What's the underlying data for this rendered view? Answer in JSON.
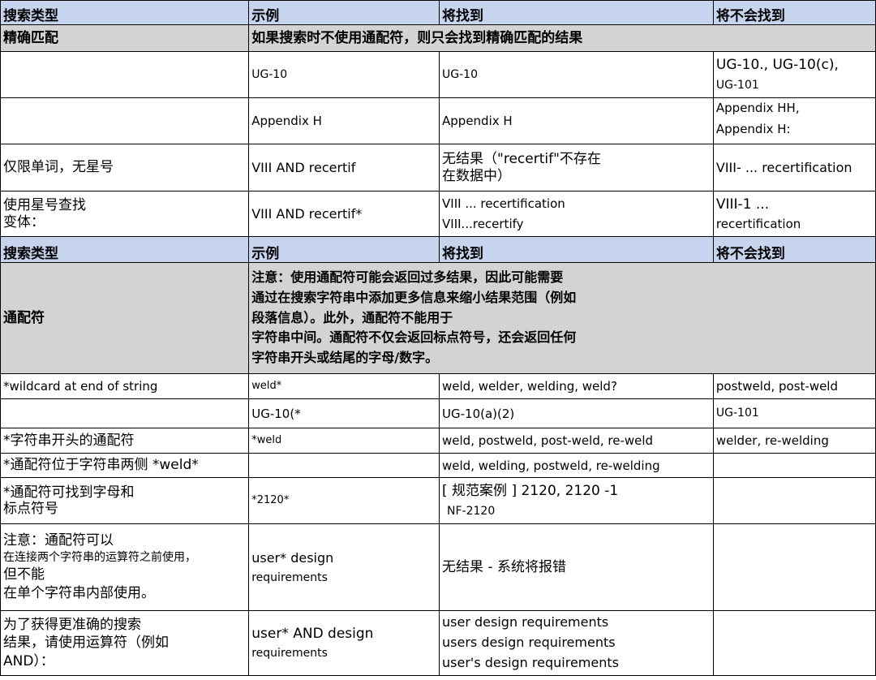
{
  "header": {
    "col1": "搜索类型",
    "col2": "示例",
    "col3": "将找到",
    "col4": "将不会找到"
  },
  "exact": {
    "label": "精确匹配",
    "note": "如果搜索时不使用通配符，则只会找到精确匹配的结果"
  },
  "rows_a": {
    "r1": {
      "example": "UG-10",
      "finds": "UG-10",
      "not_line1": "UG-10., UG-10(c),",
      "not_line2": "UG-101"
    },
    "r2": {
      "example": "Appendix H",
      "finds": "Appendix H",
      "not_line1": "Appendix HH,",
      "not_line2": "Appendix H:"
    },
    "r3": {
      "type": "仅限单词，无星号",
      "example": "VIII AND recertif",
      "finds_line1": "无结果（\"recertif\"不存在",
      "finds_line2": "在数据中）",
      "not": "VIII- ... recertification"
    },
    "r4": {
      "type_line1": "使用星号查找",
      "type_line2": "变体：",
      "example": "VIII AND recertif*",
      "finds_line1": "VIII ... recertification",
      "finds_line2": "VIII...recertify",
      "not_line1": "VIII-1 ...",
      "not_line2": "recertification"
    }
  },
  "wildcard": {
    "label": "通配符",
    "note_lines": [
      "注意：使用通配符可能会返回过多结果，因此可能需要",
      "通过在搜索字符串中添加更多信息来缩小结果范围（例如",
      "段落信息）。此外，通配符不能用于",
      "字符串中间。通配符不仅会返回标点符号，还会返回任何",
      "字符串开头或结尾的字母/数字。"
    ]
  },
  "rows_b": {
    "r1": {
      "type": "*wildcard at end of string",
      "example": "weld*",
      "finds": "weld, welder, welding, weld?",
      "not": "postweld, post-weld"
    },
    "r2": {
      "type": "",
      "example": "UG-10(*",
      "finds": "UG-10(a)(2)",
      "not": "UG-101"
    },
    "r3": {
      "type": "*字符串开头的通配符",
      "example": "*weld",
      "finds": "weld, postweld, post-weld, re-weld",
      "not": "welder, re-welding"
    },
    "r4": {
      "type": "*通配符位于字符串两侧 *weld*",
      "example": "",
      "finds": "weld, welding, postweld, re-welding",
      "not": ""
    },
    "r5": {
      "type_line1": "*通配符可找到字母和",
      "type_line2": "标点符号",
      "example": "*2120*",
      "finds_line1": "[ 规范案例 ] 2120, 2120 -1",
      "finds_line2": "NF-2120",
      "not": ""
    },
    "r6": {
      "type_line1": "注意：通配符可以",
      "type_line2": "在连接两个字符串的运算符之前使用，",
      "type_line3": "但不能",
      "type_line4": "在单个字符串内部使用。",
      "example_line1": "user* design",
      "example_line2": "requirements",
      "finds": "无结果 - 系统将报错",
      "not": ""
    },
    "r7": {
      "type_line1": "为了获得更准确的搜索",
      "type_line2": "结果，请使用运算符（例如",
      "type_line3": "AND）：",
      "example_line1": "user* AND design",
      "example_line2": "requirements",
      "finds_line1": "user design requirements",
      "finds_line2": "users design requirements",
      "finds_line3": "user's design requirements",
      "not": ""
    }
  }
}
